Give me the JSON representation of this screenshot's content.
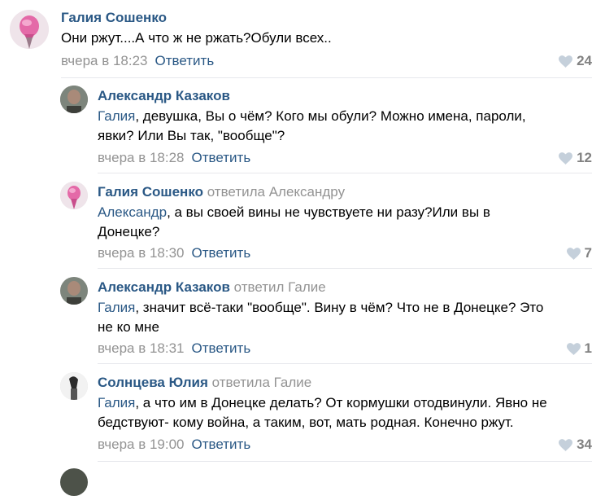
{
  "comments": [
    {
      "author": "Галия Сошенко",
      "reply_to": "",
      "text_lines": [
        "Они ржут....А что ж не ржать?Обули всех.."
      ],
      "mention": "",
      "time": "вчера в 18:23",
      "reply_label": "Ответить",
      "likes": "24"
    },
    {
      "author": "Александр Казаков",
      "reply_to": "",
      "mention": "Галия",
      "text_lines": [
        ", девушка, Вы о чём? Кого мы обули? Можно имена, пароли,",
        "явки? Или Вы так, \"вообще\"?"
      ],
      "time": "вчера в 18:28",
      "reply_label": "Ответить",
      "likes": "12"
    },
    {
      "author": "Галия Сошенко",
      "reply_to": "ответила Александру",
      "mention": "Александр",
      "text_lines": [
        ", а вы своей вины не чувствуете ни разу?Или вы в",
        "Донецке?"
      ],
      "time": "вчера в 18:30",
      "reply_label": "Ответить",
      "likes": "7"
    },
    {
      "author": "Александр Казаков",
      "reply_to": "ответил Галие",
      "mention": "Галия",
      "text_lines": [
        ", значит всё-таки \"вообще\". Вину в чём? Что не в Донецке? Это",
        "не ко мне"
      ],
      "time": "вчера в 18:31",
      "reply_label": "Ответить",
      "likes": "1"
    },
    {
      "author": "Солнцева Юлия",
      "reply_to": "ответила Галие",
      "mention": "Галия",
      "text_lines": [
        ", а что им в Донецке делать? От кормушки отодвинули. Явно не",
        "бедствуют- кому война, а таким, вот, мать родная. Конечно ржут."
      ],
      "time": "вчера в 19:00",
      "reply_label": "Ответить",
      "likes": "34"
    }
  ],
  "colors": {
    "link": "#2a5885",
    "muted": "#939393",
    "divider": "#e7e8ec"
  }
}
